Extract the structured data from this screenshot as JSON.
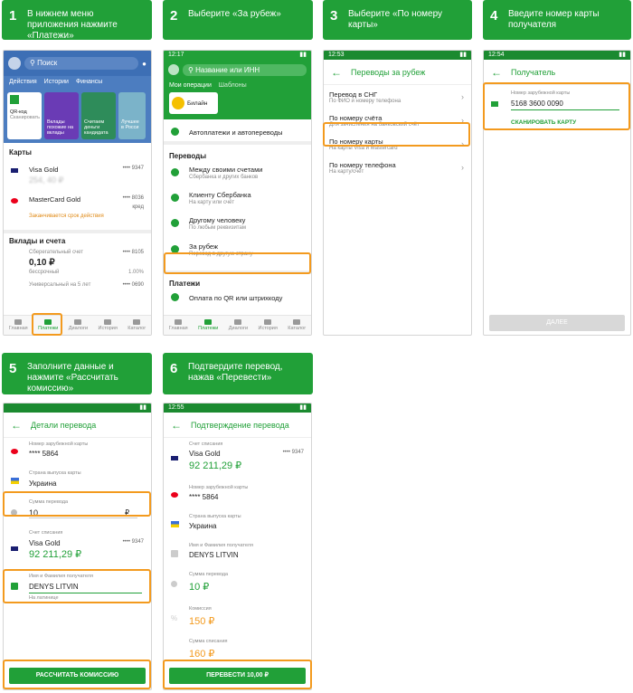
{
  "steps": [
    {
      "n": "1",
      "text": "В нижнем меню приложения нажмите «Платежи»"
    },
    {
      "n": "2",
      "text": "Выберите «За рубеж»"
    },
    {
      "n": "3",
      "text": "Выберите «По номеру карты»"
    },
    {
      "n": "4",
      "text": "Введите номер карты получателя"
    },
    {
      "n": "5",
      "text": "Заполните данные и нажмите «Рассчитать комиссию»"
    },
    {
      "n": "6",
      "text": "Подтвердите перевод, нажав «Перевести»"
    }
  ],
  "s1": {
    "search": "Поиск",
    "tabs": [
      "Действия",
      "Истории",
      "Финансы"
    ],
    "stories": [
      "QR-код",
      "Вклады похожие на вклады",
      "Считаем деньги кандидата",
      "Лучшее в Росси"
    ],
    "qr_sub": "Сканировать",
    "cards_title": "Карты",
    "visa": "Visa Gold",
    "visa_num": "•••• 9347",
    "visa_amt": "254, 40 ₽",
    "mc": "MasterCard Gold",
    "mc_num": "•••• 8036",
    "mc_amt": "кред",
    "mc_warn": "Заканчивается срок действия",
    "deposits": "Вклады и счета",
    "save": "Сберегательный счет",
    "save_num": "•••• 8105",
    "save_amt": "0,10 ₽",
    "save_sub": "бессрочный",
    "save_pct": "1.00%",
    "univ": "Универсальный на 5 лет",
    "univ_num": "•••• 0690",
    "nav": [
      "Главная",
      "Платежи",
      "Диалоги",
      "История",
      "Каталог"
    ]
  },
  "s2": {
    "time": "12:17",
    "search": "Название или ИНН",
    "tabs": [
      "Мои операции",
      "Шаблоны"
    ],
    "beeline": "Билайн",
    "auto": "Автоплатежи и автопереводы",
    "transfers": "Переводы",
    "items": [
      {
        "t": "Между своими счетами",
        "s": "Сбербанка и других банков"
      },
      {
        "t": "Клиенту Сбербанка",
        "s": "На карту или счёт"
      },
      {
        "t": "Другому человеку",
        "s": "По любым реквизитам"
      },
      {
        "t": "За рубеж",
        "s": "Перевод в другую страну"
      }
    ],
    "payments": "Платежи",
    "qr": "Оплата по QR или штрихкоду",
    "nav": [
      "Главная",
      "Платежи",
      "Диалоги",
      "История",
      "Каталог"
    ]
  },
  "s3": {
    "time": "12:53",
    "title": "Переводы за рубеж",
    "items": [
      {
        "t": "Перевод в СНГ",
        "s": "По ФИО и номеру телефона"
      },
      {
        "t": "По номеру счёта",
        "s": "Для зачисления на банковский счёт"
      },
      {
        "t": "По номеру карты",
        "s": "На карты Visa и Mastercard"
      },
      {
        "t": "По номеру телефона",
        "s": "На карту/счёт"
      }
    ]
  },
  "s4": {
    "time": "12:54",
    "title": "Получатель",
    "lbl": "Номер зарубежной карты",
    "value": "5168 3600 0090",
    "scan": "СКАНИРОВАТЬ КАРТУ",
    "next": "ДАЛЕЕ"
  },
  "s5": {
    "title": "Детали перевода",
    "card_lbl": "Номер зарубежной карты",
    "card": "**** 5864",
    "country_lbl": "Страна выпуска карты",
    "country": "Украина",
    "sum_lbl": "Сумма перевода",
    "sum": "10",
    "cur": "₽",
    "acc_lbl": "Счет списания",
    "acc": "Visa Gold",
    "acc_num": "•••• 9347",
    "acc_amt": "92 211,29 ₽",
    "name_lbl": "Имя и Фамилия получателя",
    "name": "DENYS LITVIN",
    "name_hint": "На латинице",
    "btn": "РАССЧИТАТЬ КОМИССИЮ"
  },
  "s6": {
    "time": "12:55",
    "title": "Подтверждение перевода",
    "acc_lbl": "Счет списания",
    "acc": "Visa Gold",
    "acc_num": "•••• 9347",
    "acc_amt": "92 211,29 ₽",
    "card_lbl": "Номер зарубежной карты",
    "card": "**** 5864",
    "country_lbl": "Страна выпуска карты",
    "country": "Украина",
    "name_lbl": "Имя и Фамилия получателя",
    "name": "DENYS LITVIN",
    "sum_lbl": "Сумма перевода",
    "sum": "10 ₽",
    "fee_lbl": "Комиссия",
    "fee": "150 ₽",
    "total_lbl": "Сумма списания",
    "total": "160 ₽",
    "btn": "ПЕРЕВЕСТИ 10,00 ₽"
  },
  "colors": {
    "green": "#21a038",
    "orange": "#f39a1e"
  }
}
